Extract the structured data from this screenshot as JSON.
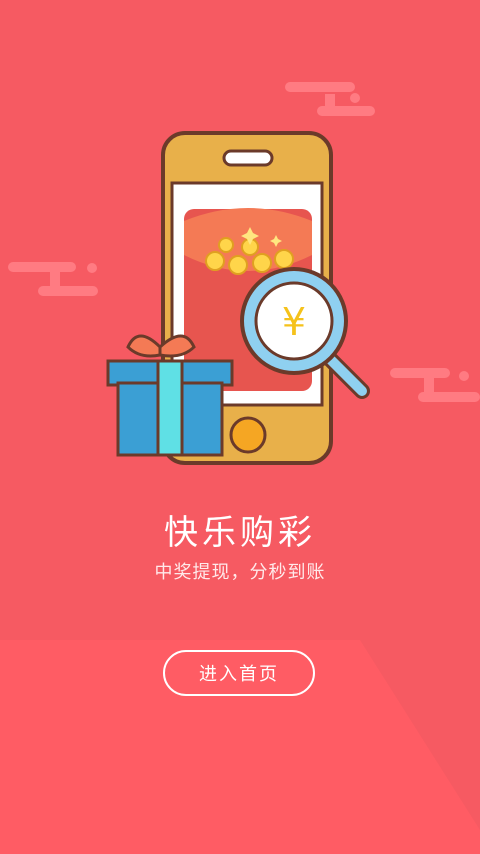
{
  "main": {
    "title": "快乐购彩",
    "subtitle": "中奖提现，分秒到账"
  },
  "actions": {
    "enter_label": "进入首页"
  },
  "illustration": {
    "currency_symbol": "¥"
  },
  "colors": {
    "background": "#f65a62",
    "phone_body": "#e8b04a",
    "gift_box": "#3b9fd4",
    "gift_ribbon": "#5fe0e5",
    "magnifier": "#8fd0f0",
    "envelope": "#e7554f"
  },
  "icons": [
    "phone-illustration",
    "red-envelope-icon",
    "magnifier-icon",
    "gift-box-icon",
    "cloud-decoration"
  ]
}
